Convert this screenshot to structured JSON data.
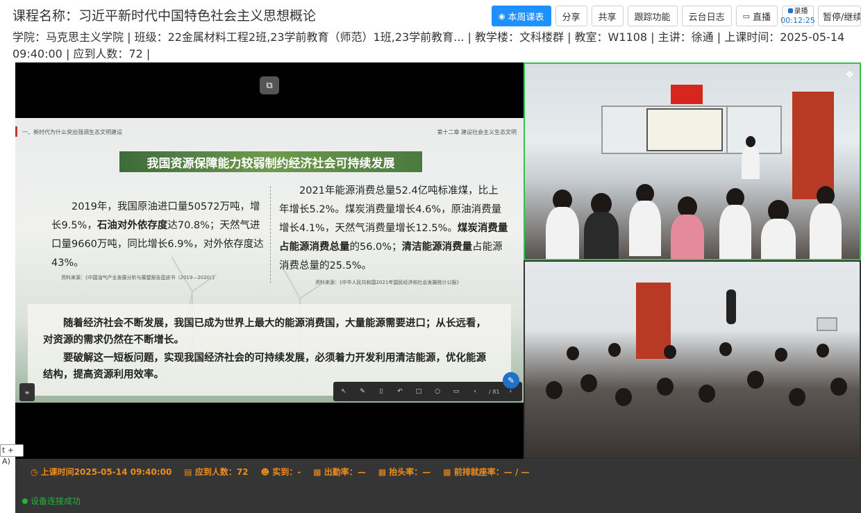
{
  "header": {
    "title": "课程名称：习近平新时代中国特色社会主义思想概论",
    "info": "学院：马克思主义学院 | 班级：22金属材料工程2班,23学前教育（师范）1班,23学前教育... | 教学楼：文科楼群 | 教室：W1108 | 主讲：徐通 | 上课时间：2025-05-14 09:40:00 | 应到人数：72 |"
  },
  "toolbar": {
    "week_schedule": "本周课表",
    "share": "分享",
    "cowork": "共享",
    "track": "跟踪功能",
    "cloud_log": "云台日志",
    "live": "直播",
    "rec_label": "录播",
    "rec_time": "00:12:25",
    "pause": "暂停/继续"
  },
  "slide": {
    "section": "一、新时代为什么突出强调生态文明建设",
    "chapter": "第十二章  建设社会主义生态文明",
    "banner": "我国资源保障能力较弱制约经济社会可持续发展",
    "left_text_a": "2019年，我国原油进口量50572万吨，增长9.5%，",
    "left_text_bold": "石油对外依存度",
    "left_text_b": "达70.8%；天然气进口量9660万吨，同比增长6.9%，对外依存度达43%。",
    "left_source": "资料来源：《中国油气产业发展分析与展望报告蓝皮书（2019—2020）》",
    "right_text_a": "2021年能源消费总量52.4亿吨标准煤，比上年增长5.2%。煤炭消费量增长4.6%，原油消费量增长4.1%，天然气消费量增长12.5%。",
    "right_text_bold1": "煤炭消费量占能源消费总量",
    "right_text_b": "的56.0%；",
    "right_text_bold2": "清洁能源消费量",
    "right_text_c": "占能源消费总量的25.5%。",
    "right_source": "资料来源：《中华人民共和国2021年国民经济和社会发展统计公报》",
    "box_p1": "随着经济社会不断发展，我国已成为世界上最大的能源消费国，大量能源需要进口；从长远看，对资源的需求仍然在不断增长。",
    "box_p2": "要破解这一短板问题，实现我国经济社会的可持续发展，必须着力开发利用清洁能源，优化能源结构，提高资源利用效率。",
    "page": "/ 81"
  },
  "shortcut_tip": "t + A)",
  "status": {
    "class_time": "上课时间2025-05-14 09:40:00",
    "expected": "应到人数：72",
    "actual": "实到：-",
    "attendance": "出勤率：—",
    "head_up": "抬头率：—",
    "front_row": "前排就座率：— / —",
    "connection": "设备连接成功"
  },
  "colors": {
    "accent": "#1e90ff",
    "status_orange": "#ef8c1c",
    "connected_green": "#22b33a",
    "camera_border": "#35c24a"
  }
}
